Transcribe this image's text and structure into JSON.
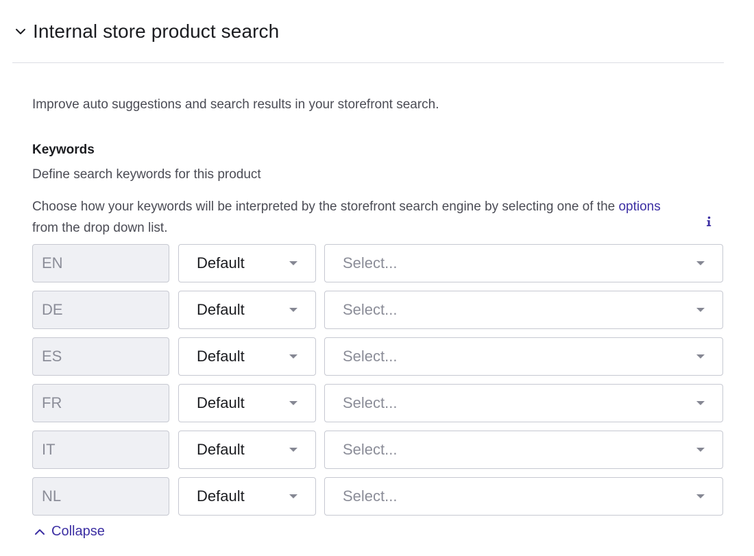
{
  "section": {
    "title": "Internal store product search",
    "intro": "Improve auto suggestions and search results in your storefront search."
  },
  "field": {
    "label": "Keywords",
    "description": "Define search keywords for this product",
    "help_before": "Choose how your keywords will be interpreted by the storefront search engine by selecting one of the ",
    "help_link": "options",
    "help_after": " from the drop down list."
  },
  "rows": [
    {
      "lang": "EN",
      "mode": "Default",
      "placeholder": "Select..."
    },
    {
      "lang": "DE",
      "mode": "Default",
      "placeholder": "Select..."
    },
    {
      "lang": "ES",
      "mode": "Default",
      "placeholder": "Select..."
    },
    {
      "lang": "FR",
      "mode": "Default",
      "placeholder": "Select..."
    },
    {
      "lang": "IT",
      "mode": "Default",
      "placeholder": "Select..."
    },
    {
      "lang": "NL",
      "mode": "Default",
      "placeholder": "Select..."
    }
  ],
  "collapse": {
    "label": "Collapse"
  },
  "icons": {
    "section_toggle": "chevron-down-icon",
    "info": "info-icon",
    "dropdown": "caret-down-icon",
    "collapse": "chevron-up-icon"
  },
  "colors": {
    "accent": "#3c2fa3",
    "text": "#1b1c20",
    "muted": "#4b4c55",
    "disabled_bg": "#eff0f4",
    "border": "#c6c8d1"
  }
}
